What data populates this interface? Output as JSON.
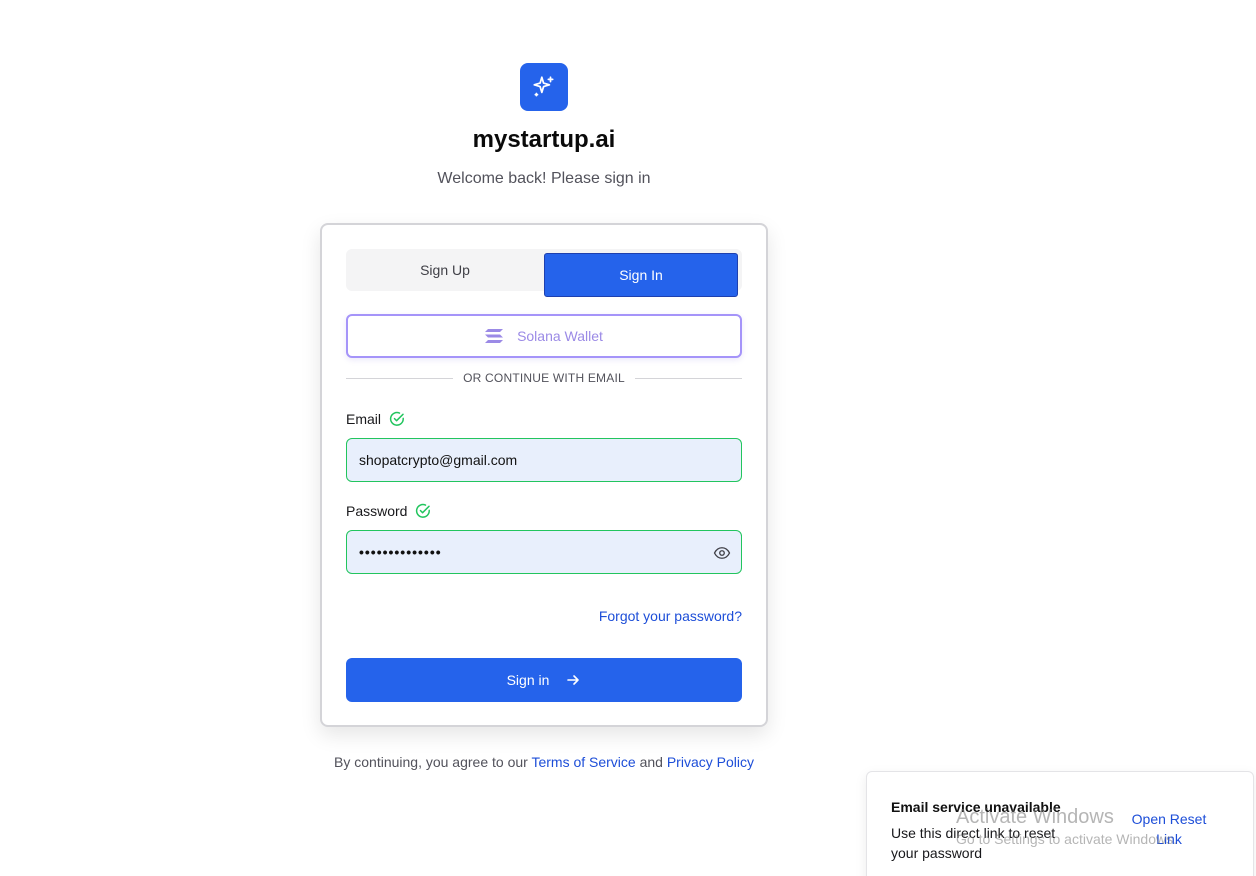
{
  "brand": {
    "name": "mystartup.ai",
    "subtitle": "Welcome back! Please sign in"
  },
  "auth_tabs": {
    "sign_up": "Sign Up",
    "sign_in": "Sign In",
    "active": "sign_in"
  },
  "wallet": {
    "label": "Solana Wallet"
  },
  "divider": {
    "text": "OR CONTINUE WITH EMAIL"
  },
  "form": {
    "email_label": "Email",
    "email_value": "shopatcrypto@gmail.com",
    "email_valid": true,
    "password_label": "Password",
    "password_masked": "••••••••••••••",
    "password_valid": true,
    "forgot_link": "Forgot your password?",
    "submit_label": "Sign in"
  },
  "terms": {
    "prefix": "By continuing, you agree to our ",
    "tos_link": "Terms of Service",
    "middle": " and ",
    "privacy_link": "Privacy Policy"
  },
  "toast": {
    "title": "Email service unavailable",
    "message": "Use this direct link to reset your password",
    "action": "Open Reset Link"
  },
  "watermark": {
    "title": "Activate Windows",
    "subtitle": "Go to Settings to activate Windows."
  },
  "colors": {
    "primary": "#2563eb",
    "link": "#1d4ed8",
    "valid": "#22c55e",
    "wallet_accent": "#a594f9",
    "input_bg": "#e8effc"
  },
  "icons": {
    "logo": "sparkles-icon",
    "wallet": "solana-icon",
    "valid": "check-circle-icon",
    "password_toggle": "eye-icon",
    "submit": "arrow-right-icon"
  }
}
